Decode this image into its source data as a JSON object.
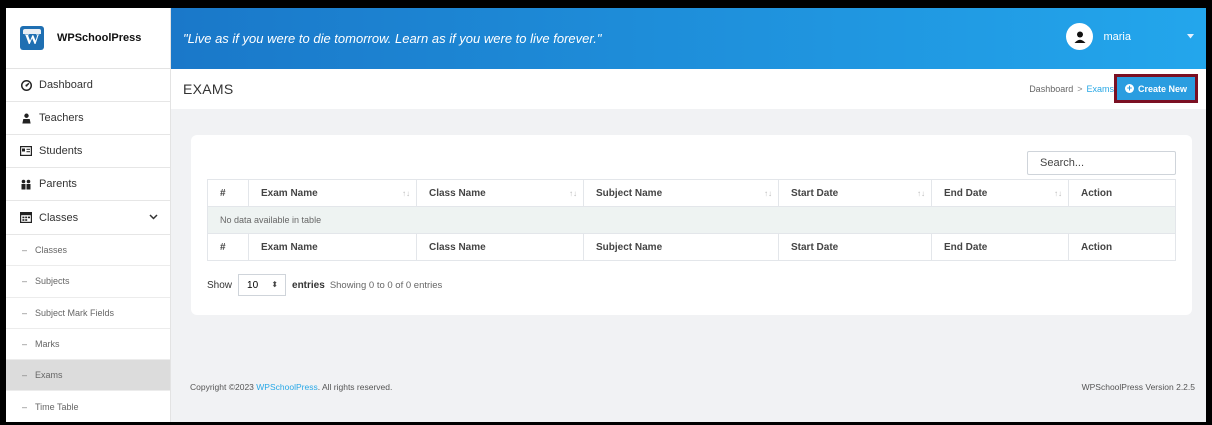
{
  "brand": {
    "name": "WPSchoolPress"
  },
  "header": {
    "quote": "\"Live as if you were to die tomorrow. Learn as if you were to live forever.\"",
    "username": "maria"
  },
  "sidebar": {
    "items": [
      {
        "label": "Dashboard",
        "icon": "dashboard-icon"
      },
      {
        "label": "Teachers",
        "icon": "teacher-icon"
      },
      {
        "label": "Students",
        "icon": "student-id-icon"
      },
      {
        "label": "Parents",
        "icon": "parents-icon"
      },
      {
        "label": "Classes",
        "icon": "classes-icon"
      }
    ],
    "subitems": [
      "Classes",
      "Subjects",
      "Subject Mark Fields",
      "Marks",
      "Exams",
      "Time Table"
    ]
  },
  "page": {
    "title": "EXAMS",
    "breadcrumb": {
      "home": "Dashboard",
      "current": "Exams",
      "separator": ">"
    },
    "create_label": "Create New"
  },
  "table": {
    "search_placeholder": "Search...",
    "columns": [
      "#",
      "Exam Name",
      "Class Name",
      "Subject Name",
      "Start Date",
      "End Date",
      "Action"
    ],
    "empty_message": "No data available in table",
    "length_label_show": "Show",
    "length_value": "10",
    "length_label_entries": "entries",
    "info": "Showing 0 to 0 of 0 entries"
  },
  "footer": {
    "copyright_prefix": "Copyright ©2023 ",
    "copyright_link": "WPSchoolPress",
    "copyright_suffix": ". All rights reserved.",
    "version": "WPSchoolPress Version 2.2.5"
  },
  "colors": {
    "accent": "#2a9de0",
    "header_start": "#1a78c9",
    "header_end": "#23a6ec",
    "highlight_border": "#7b1023"
  }
}
